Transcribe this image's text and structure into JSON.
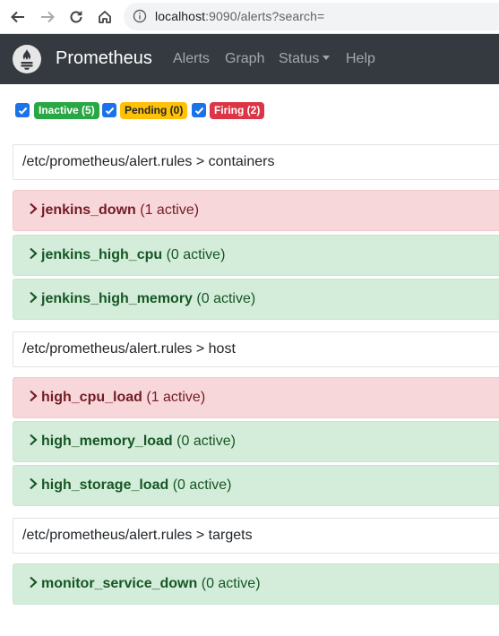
{
  "browser": {
    "url_host": "localhost",
    "url_rest": ":9090/alerts?search="
  },
  "navbar": {
    "brand": "Prometheus",
    "links": [
      "Alerts",
      "Graph",
      "Status",
      "Help"
    ]
  },
  "filters": [
    {
      "label": "Inactive (5)",
      "checked": true,
      "color": "#28a745"
    },
    {
      "label": "Pending (0)",
      "checked": true,
      "color": "#ffc107"
    },
    {
      "label": "Firing (2)",
      "checked": true,
      "color": "#dc3545"
    }
  ],
  "groups": [
    {
      "header": "/etc/prometheus/alert.rules > containers",
      "alerts": [
        {
          "name": "jenkins_down",
          "count": "(1 active)",
          "state": "firing"
        },
        {
          "name": "jenkins_high_cpu",
          "count": "(0 active)",
          "state": "inactive"
        },
        {
          "name": "jenkins_high_memory",
          "count": "(0 active)",
          "state": "inactive"
        }
      ]
    },
    {
      "header": "/etc/prometheus/alert.rules > host",
      "alerts": [
        {
          "name": "high_cpu_load",
          "count": "(1 active)",
          "state": "firing"
        },
        {
          "name": "high_memory_load",
          "count": "(0 active)",
          "state": "inactive"
        },
        {
          "name": "high_storage_load",
          "count": "(0 active)",
          "state": "inactive"
        }
      ]
    },
    {
      "header": "/etc/prometheus/alert.rules > targets",
      "alerts": [
        {
          "name": "monitor_service_down",
          "count": "(0 active)",
          "state": "inactive"
        }
      ]
    }
  ],
  "colors": {
    "navbar_bg": "#343a40",
    "firing_bg": "#f8d7da",
    "inactive_bg": "#d4edda"
  }
}
